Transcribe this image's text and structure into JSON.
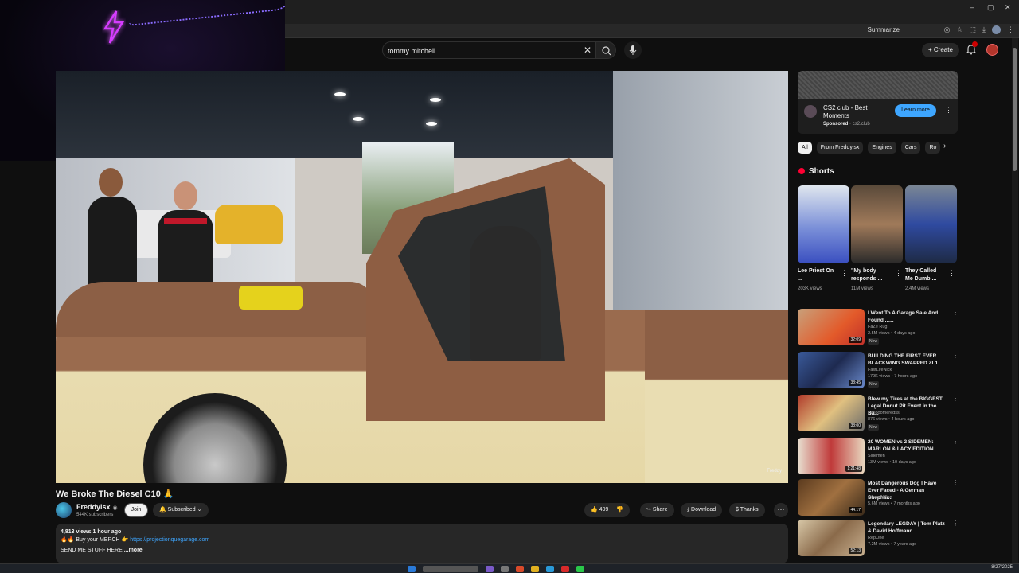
{
  "browser": {
    "summarize_label": "Summarize",
    "window_controls": [
      "–",
      "▢",
      "✕"
    ]
  },
  "masthead": {
    "search_value": "tommy mitchell",
    "create_label": "Create"
  },
  "video": {
    "title": "We Broke The Diesel C10 🙏",
    "watermark": "Freddy"
  },
  "channel": {
    "name": "Freddylsx",
    "subscribers": "544K subscribers",
    "join_label": "Join",
    "subscribed_label": "Subscribed"
  },
  "actions": {
    "likes": "499",
    "share_label": "Share",
    "download_label": "Download",
    "thanks_label": "Thanks"
  },
  "description": {
    "stats": "4,813 views  1 hour ago",
    "merch_prefix": "🔥🔥 Buy your MERCH 👉",
    "merch_link": "https://projectionquegarage.com",
    "line3": "SEND ME STUFF HERE",
    "more_label": "...more"
  },
  "ad": {
    "title": "CS2 club - Best Moments",
    "sponsored": "Sponsored",
    "domain": "cs2.club",
    "cta": "Learn more"
  },
  "chips": [
    "All",
    "From Freddylsx",
    "Engines",
    "Cars",
    "Ro"
  ],
  "shorts": {
    "heading": "Shorts",
    "items": [
      {
        "title": "Lee Priest On ...",
        "views": "203K views"
      },
      {
        "title": "\"My body responds ...",
        "views": "11M views"
      },
      {
        "title": "They Called Me Dumb ...",
        "views": "2.4M views"
      }
    ]
  },
  "recommendations": [
    {
      "title": "I Went To A Garage Sale And Found ......",
      "channel": "FaZe Rug",
      "meta": "2.5M views • 4 days ago",
      "badge": "New",
      "duration": "32:09"
    },
    {
      "title": "BUILDING THE FIRST EVER BLACKWING SWAPPED ZL1...",
      "channel": "FastLifeNick",
      "meta": "179K views • 7 hours ago",
      "badge": "New",
      "duration": "38:45"
    },
    {
      "title": "Blew my Tires at the BIGGEST Legal Donut Pit Event in the Ba...",
      "channel": "Hellooomeredss",
      "meta": "876 views • 4 hours ago",
      "badge": "New",
      "duration": "38:00"
    },
    {
      "title": "20 WOMEN vs 2 SIDEMEN: MARLON & LACY EDITION",
      "channel": "Sidemen",
      "meta": "13M views • 10 days ago",
      "badge": "",
      "duration": "1:21:48"
    },
    {
      "title": "Most Dangerous Dog I Have Ever Faced - A German Shephar...",
      "channel": "Cesar Millan",
      "meta": "5.6M views • 7 months ago",
      "badge": "",
      "duration": "44:17"
    },
    {
      "title": "Legendary LEGDAY | Tom Platz & David Hoffmann",
      "channel": "RepOne",
      "meta": "7.2M views • 7 years ago",
      "badge": "",
      "duration": "52:13"
    }
  ],
  "taskbar": {
    "date": "8/27/2025"
  },
  "colors": {
    "background": "#0f0f0f",
    "accent": "#3ea6ff",
    "youtube_red": "#ff0033"
  }
}
